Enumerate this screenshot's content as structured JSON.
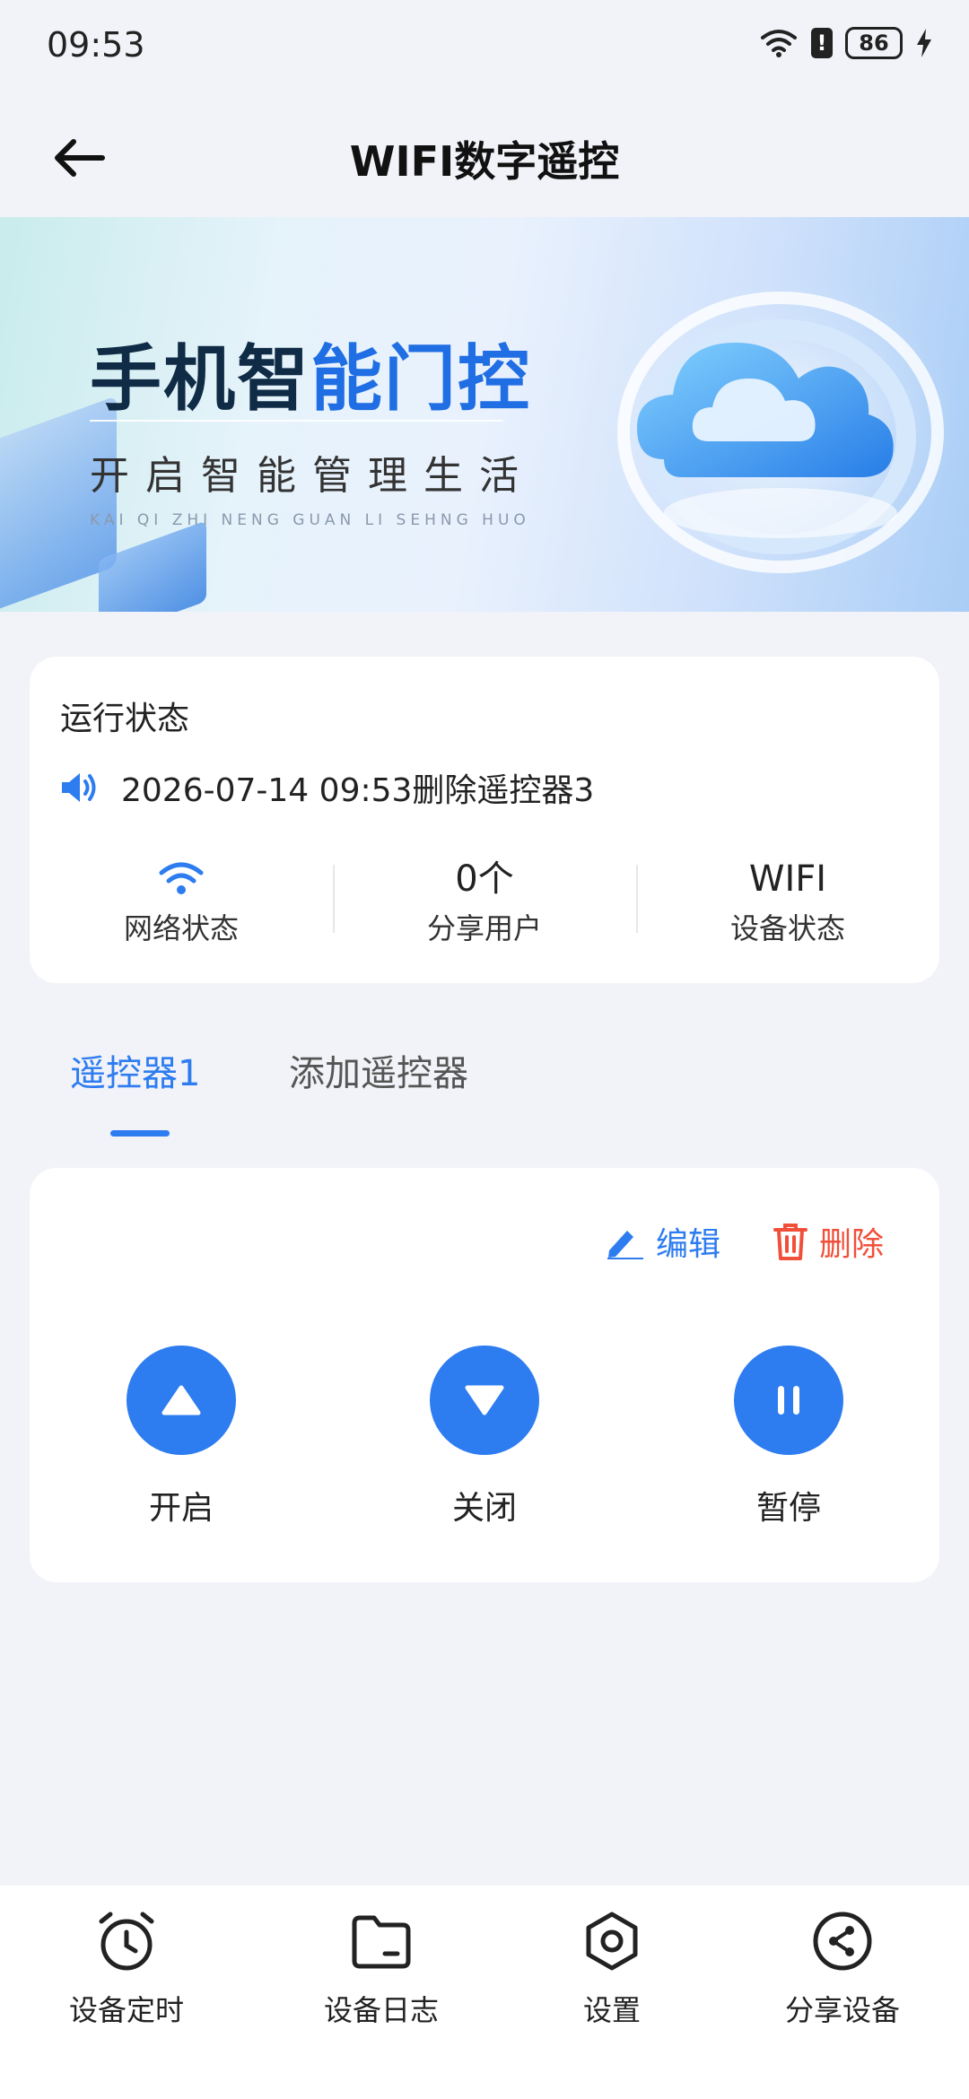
{
  "status_bar": {
    "time": "09:53",
    "battery": "86",
    "alert": "!"
  },
  "header": {
    "title": "WIFI数字遥控"
  },
  "banner": {
    "title_dark": "手机智",
    "title_blue": "能门控",
    "subtitle": "开启智能管理生活",
    "pinyin": "KAI QI ZHI NENG GUAN LI SEHNG HUO"
  },
  "status_card": {
    "title": "运行状态",
    "notice": "2026-07-14 09:53删除遥控器3",
    "stats": [
      {
        "value": "",
        "label": "网络状态",
        "icon": "wifi-icon"
      },
      {
        "value": "0个",
        "label": "分享用户"
      },
      {
        "value": "WIFI",
        "label": "设备状态"
      }
    ]
  },
  "tabs": [
    {
      "label": "遥控器1",
      "active": true
    },
    {
      "label": "添加遥控器",
      "active": false
    }
  ],
  "remote": {
    "edit_label": "编辑",
    "delete_label": "删除",
    "controls": [
      {
        "label": "开启",
        "icon": "triangle-up-icon"
      },
      {
        "label": "关闭",
        "icon": "triangle-down-icon"
      },
      {
        "label": "暂停",
        "icon": "pause-icon"
      }
    ]
  },
  "bottom_nav": [
    {
      "label": "设备定时",
      "icon": "alarm-clock-icon"
    },
    {
      "label": "设备日志",
      "icon": "folder-icon"
    },
    {
      "label": "设置",
      "icon": "hexagon-settings-icon"
    },
    {
      "label": "分享设备",
      "icon": "share-icon"
    }
  ],
  "colors": {
    "accent": "#2d7cf0",
    "danger": "#f0503a",
    "background": "#f2f3f8"
  }
}
